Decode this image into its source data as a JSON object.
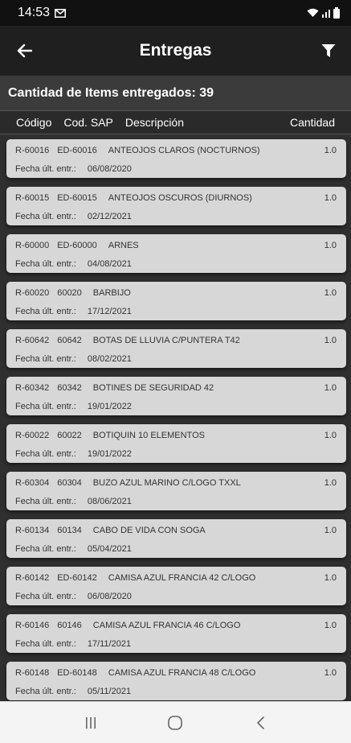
{
  "status_bar": {
    "time": "14:53",
    "icons": [
      "mail-icon",
      "wifi-icon",
      "signal-icon",
      "battery-icon"
    ]
  },
  "header": {
    "title": "Entregas",
    "back_icon": "arrow-back-icon",
    "filter_icon": "filter-icon"
  },
  "summary": {
    "text": "Cantidad de Items entregados: 39"
  },
  "columns": {
    "code": "Código",
    "sap": "Cod. SAP",
    "description": "Descripción",
    "quantity": "Cantidad"
  },
  "date_label": "Fecha últ. entr.:",
  "items": [
    {
      "code": "R-60016",
      "sap": "ED-60016",
      "description": "ANTEOJOS CLAROS (NOCTURNOS)",
      "quantity": "1.0",
      "date": "06/08/2020"
    },
    {
      "code": "R-60015",
      "sap": "ED-60015",
      "description": "ANTEOJOS OSCUROS (DIURNOS)",
      "quantity": "1.0",
      "date": "02/12/2021"
    },
    {
      "code": "R-60000",
      "sap": "ED-60000",
      "description": "ARNES",
      "quantity": "1.0",
      "date": "04/08/2021"
    },
    {
      "code": "R-60020",
      "sap": "60020",
      "description": "BARBIJO",
      "quantity": "1.0",
      "date": "17/12/2021"
    },
    {
      "code": "R-60642",
      "sap": "60642",
      "description": "BOTAS DE LLUVIA C/PUNTERA T42",
      "quantity": "1.0",
      "date": "08/02/2021"
    },
    {
      "code": "R-60342",
      "sap": "60342",
      "description": "BOTINES DE SEGURIDAD 42",
      "quantity": "1.0",
      "date": "19/01/2022"
    },
    {
      "code": "R-60022",
      "sap": "60022",
      "description": "BOTIQUIN 10 ELEMENTOS",
      "quantity": "1.0",
      "date": "19/01/2022"
    },
    {
      "code": "R-60304",
      "sap": "60304",
      "description": "BUZO AZUL MARINO C/LOGO TXXL",
      "quantity": "1.0",
      "date": "08/06/2021"
    },
    {
      "code": "R-60134",
      "sap": "60134",
      "description": "CABO DE VIDA CON SOGA",
      "quantity": "1.0",
      "date": "05/04/2021"
    },
    {
      "code": "R-60142",
      "sap": "ED-60142",
      "description": "CAMISA AZUL FRANCIA 42 C/LOGO",
      "quantity": "1.0",
      "date": "06/08/2020"
    },
    {
      "code": "R-60146",
      "sap": "60146",
      "description": "CAMISA AZUL FRANCIA 46 C/LOGO",
      "quantity": "1.0",
      "date": "17/11/2021"
    },
    {
      "code": "R-60148",
      "sap": "ED-60148",
      "description": "CAMISA AZUL FRANCIA 48 C/LOGO",
      "quantity": "1.0",
      "date": "05/11/2021"
    }
  ],
  "nav_bar": {
    "recents_icon": "recent-apps-icon",
    "home_icon": "home-icon",
    "back_icon": "nav-back-icon"
  }
}
